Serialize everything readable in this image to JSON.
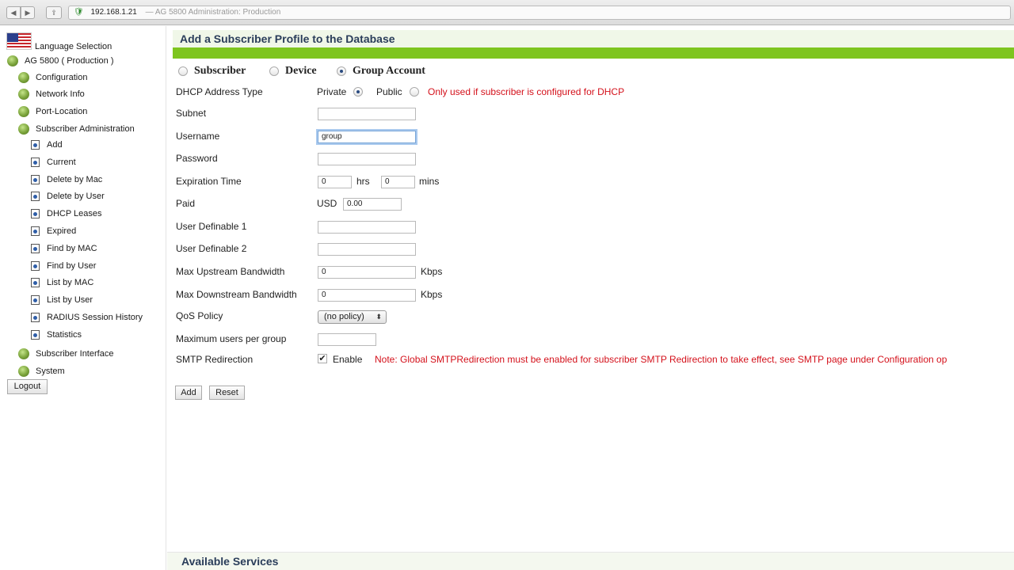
{
  "browser": {
    "url_host": "192.168.1.21",
    "url_title": "— AG 5800  Administration:  Production"
  },
  "sidebar": {
    "language": "Language Selection",
    "device": "AG 5800 ( Production )",
    "sections": {
      "configuration": "Configuration",
      "network_info": "Network Info",
      "port_location": "Port-Location",
      "subscriber_admin": "Subscriber Administration",
      "subscriber_interface": "Subscriber Interface",
      "system": "System"
    },
    "admin_items": [
      "Add",
      "Current",
      "Delete by Mac",
      "Delete by User",
      "DHCP Leases",
      "Expired",
      "Find by MAC",
      "Find by User",
      "List by MAC",
      "List by User",
      "RADIUS Session History",
      "Statistics"
    ],
    "logout": "Logout"
  },
  "main": {
    "title": "Add a Subscriber Profile to the Database",
    "type_options": [
      "Subscriber",
      "Device",
      "Group Account"
    ],
    "selected_type": "Group Account",
    "fields": {
      "dhcp_type": "DHCP Address Type",
      "private": "Private",
      "public": "Public",
      "dhcp_note": "Only used if subscriber is configured for DHCP",
      "subnet": "Subnet",
      "username": "Username",
      "username_value": "group",
      "password": "Password",
      "expiration": "Expiration Time",
      "exp_hrs_value": "0",
      "hrs": "hrs",
      "exp_mins_value": "0",
      "mins": "mins",
      "paid": "Paid",
      "currency": "USD",
      "paid_value": "0.00",
      "udf1": "User Definable 1",
      "udf2": "User Definable 2",
      "max_up": "Max Upstream Bandwidth",
      "max_up_value": "0",
      "max_down": "Max Downstream Bandwidth",
      "max_down_value": "0",
      "kbps": "Kbps",
      "qos": "QoS Policy",
      "qos_value": "(no policy)",
      "max_users": "Maximum users per group",
      "smtp": "SMTP Redirection",
      "enable": "Enable",
      "smtp_note": "Note: Global SMTPRedirection must be enabled for subscriber SMTP Redirection to take effect, see SMTP page under Configuration op"
    },
    "buttons": {
      "add": "Add",
      "reset": "Reset"
    },
    "footer_title": "Available Services"
  },
  "colors": {
    "accent_green": "#7ec51f",
    "title_blue": "#2a3d5a",
    "note_red": "#d4111b"
  }
}
